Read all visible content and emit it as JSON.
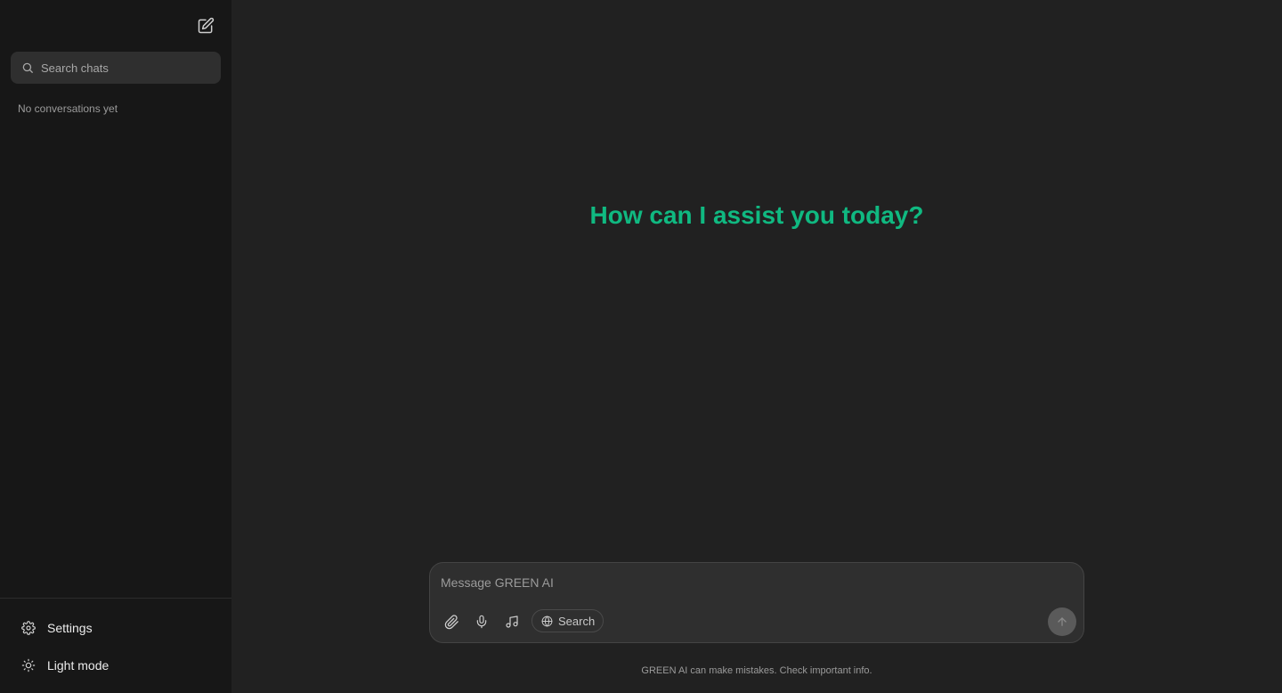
{
  "sidebar": {
    "search_placeholder": "Search chats",
    "empty_message": "No conversations yet",
    "bottom_items": [
      {
        "label": "Settings",
        "icon": "gear-icon"
      },
      {
        "label": "Light mode",
        "icon": "sun-icon"
      }
    ]
  },
  "main": {
    "greeting": "How can I assist you today?",
    "composer": {
      "placeholder": "Message GREEN AI",
      "search_label": "Search"
    },
    "disclaimer": "GREEN AI can make mistakes. Check important info."
  },
  "colors": {
    "accent": "#10b981",
    "sidebar_bg": "#171717",
    "main_bg": "#212121"
  }
}
